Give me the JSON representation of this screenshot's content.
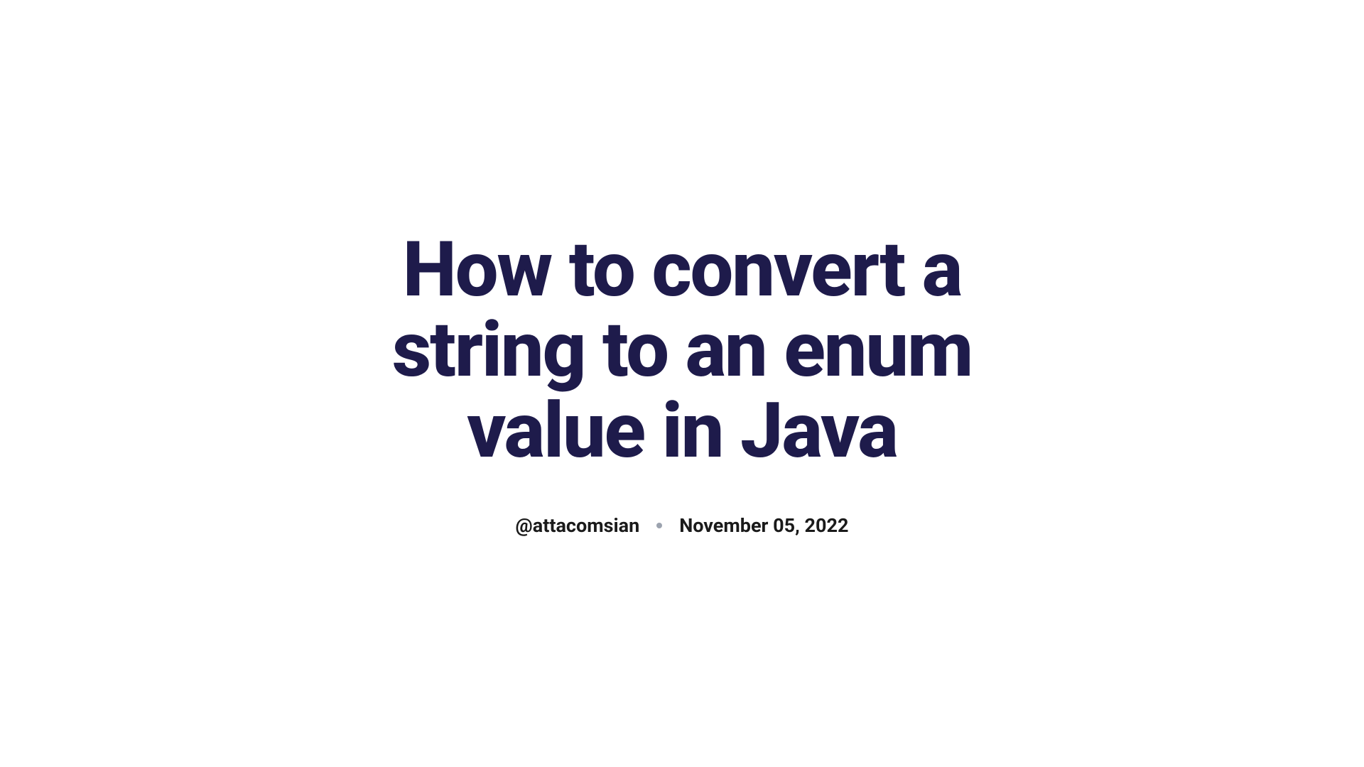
{
  "article": {
    "title": "How to convert a string to an enum value in Java",
    "author": "@attacomsian",
    "date": "November 05, 2022"
  }
}
